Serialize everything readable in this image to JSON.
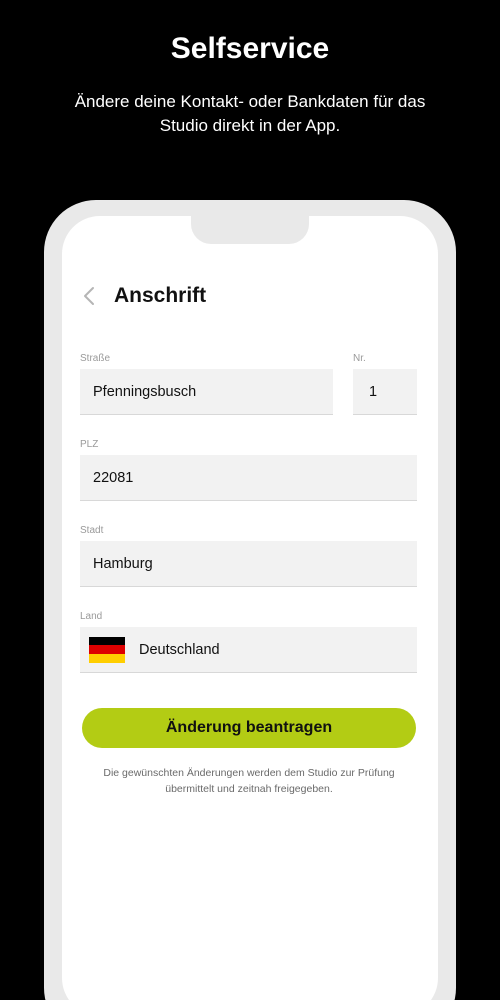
{
  "promo": {
    "title": "Selfservice",
    "subtitle": "Ändere deine Kontakt- oder Bankdaten für das Studio direkt in der App."
  },
  "screen": {
    "title": "Anschrift",
    "back_icon": "chevron-left-icon"
  },
  "form": {
    "street": {
      "label": "Straße",
      "value": "Pfenningsbusch"
    },
    "number": {
      "label": "Nr.",
      "value": "1"
    },
    "zip": {
      "label": "PLZ",
      "value": "22081"
    },
    "city": {
      "label": "Stadt",
      "value": "Hamburg"
    },
    "country": {
      "label": "Land",
      "value": "Deutschland",
      "flag_icon": "germany-flag-icon"
    }
  },
  "submit": {
    "label": "Änderung beantragen"
  },
  "info": "Die gewünschten Änderungen werden dem Studio zur Prüfung übermittelt und zeitnah freigegeben.",
  "colors": {
    "background": "#000000",
    "accent": "#b3cc14",
    "field_bg": "#f2f2f2",
    "flag_black": "#000000",
    "flag_red": "#dd0000",
    "flag_gold": "#ffce00"
  }
}
